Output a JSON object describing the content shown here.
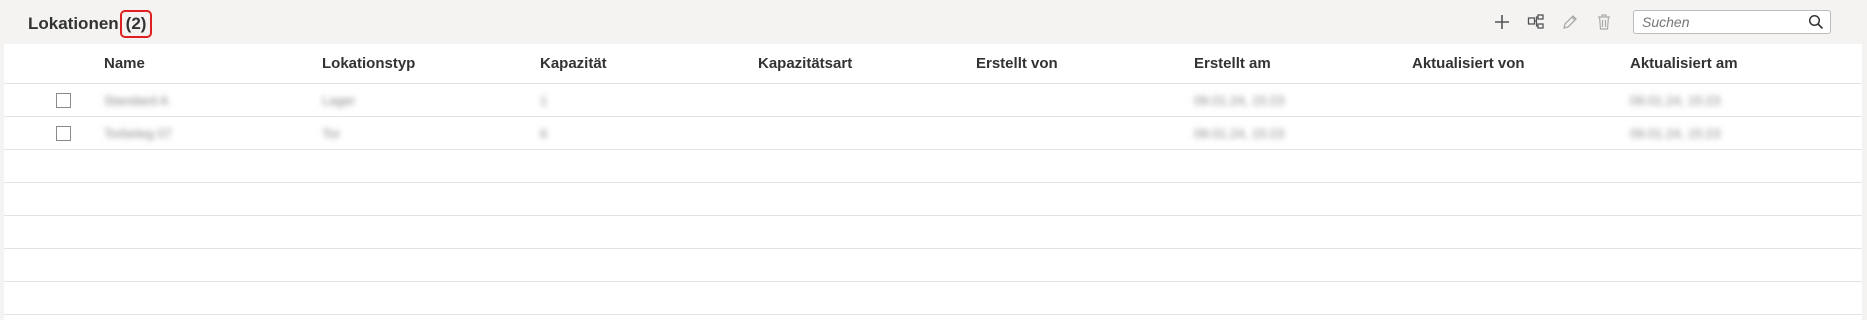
{
  "header": {
    "title": "Lokationen",
    "count": "(2)",
    "search_placeholder": "Suchen"
  },
  "columns": [
    "Name",
    "Lokationstyp",
    "Kapazität",
    "Kapazitätsart",
    "Erstellt von",
    "Erstellt am",
    "Aktualisiert von",
    "Aktualisiert am"
  ],
  "rows": [
    {
      "name": "Standard A",
      "type": "Lager",
      "capacity": "1",
      "capacity_kind": "",
      "created_by": "",
      "created_at": "09.01.24, 15:23",
      "updated_by": "",
      "updated_at": "09.01.24, 15:23"
    },
    {
      "name": "Torbeleg 07",
      "type": "Tor",
      "capacity": "6",
      "capacity_kind": "",
      "created_by": "",
      "created_at": "09.01.24, 15:23",
      "updated_by": "",
      "updated_at": "09.01.24, 15:23"
    }
  ],
  "icons": [
    "plus-icon",
    "hierarchy-icon",
    "pencil-icon",
    "trash-icon",
    "search-icon"
  ],
  "colors": {
    "count_highlight": "#e02020"
  }
}
